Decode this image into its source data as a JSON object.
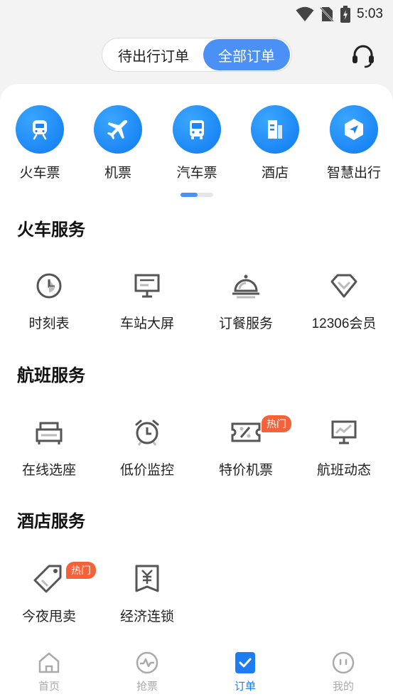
{
  "status_bar": {
    "time": "5:03"
  },
  "header": {
    "tabs": [
      {
        "label": "待出行订单",
        "active": false
      },
      {
        "label": "全部订单",
        "active": true
      }
    ],
    "support_icon": "headset-icon"
  },
  "categories": [
    {
      "label": "火车票",
      "icon": "train-icon"
    },
    {
      "label": "机票",
      "icon": "plane-icon"
    },
    {
      "label": "汽车票",
      "icon": "bus-icon"
    },
    {
      "label": "酒店",
      "icon": "hotel-icon"
    },
    {
      "label": "智慧出行",
      "icon": "navigation-icon"
    }
  ],
  "sections": {
    "train": {
      "title": "火车服务",
      "items": [
        {
          "label": "时刻表",
          "icon": "clock-icon"
        },
        {
          "label": "车站大屏",
          "icon": "station-screen-icon"
        },
        {
          "label": "订餐服务",
          "icon": "food-cloche-icon"
        },
        {
          "label": "12306会员",
          "icon": "diamond-icon"
        }
      ]
    },
    "flight": {
      "title": "航班服务",
      "items": [
        {
          "label": "在线选座",
          "icon": "seat-icon"
        },
        {
          "label": "低价监控",
          "icon": "alarm-clock-icon"
        },
        {
          "label": "特价机票",
          "icon": "discount-ticket-icon",
          "badge": "热门"
        },
        {
          "label": "航班动态",
          "icon": "flight-status-monitor-icon"
        }
      ]
    },
    "hotel": {
      "title": "酒店服务",
      "items": [
        {
          "label": "今夜甩卖",
          "icon": "price-tag-icon",
          "badge": "热门"
        },
        {
          "label": "经济连锁",
          "icon": "yen-receipt-icon"
        }
      ]
    }
  },
  "bottom_nav": [
    {
      "label": "首页",
      "icon": "home-icon",
      "active": false
    },
    {
      "label": "抢票",
      "icon": "pulse-icon",
      "active": false
    },
    {
      "label": "订单",
      "icon": "order-check-icon",
      "active": true
    },
    {
      "label": "我的",
      "icon": "profile-face-icon",
      "active": false
    }
  ],
  "colors": {
    "accent": "#4a90f5",
    "category_blue": "#1a86f5",
    "badge": "#f4623a",
    "nav_active": "#1e7cf2"
  }
}
